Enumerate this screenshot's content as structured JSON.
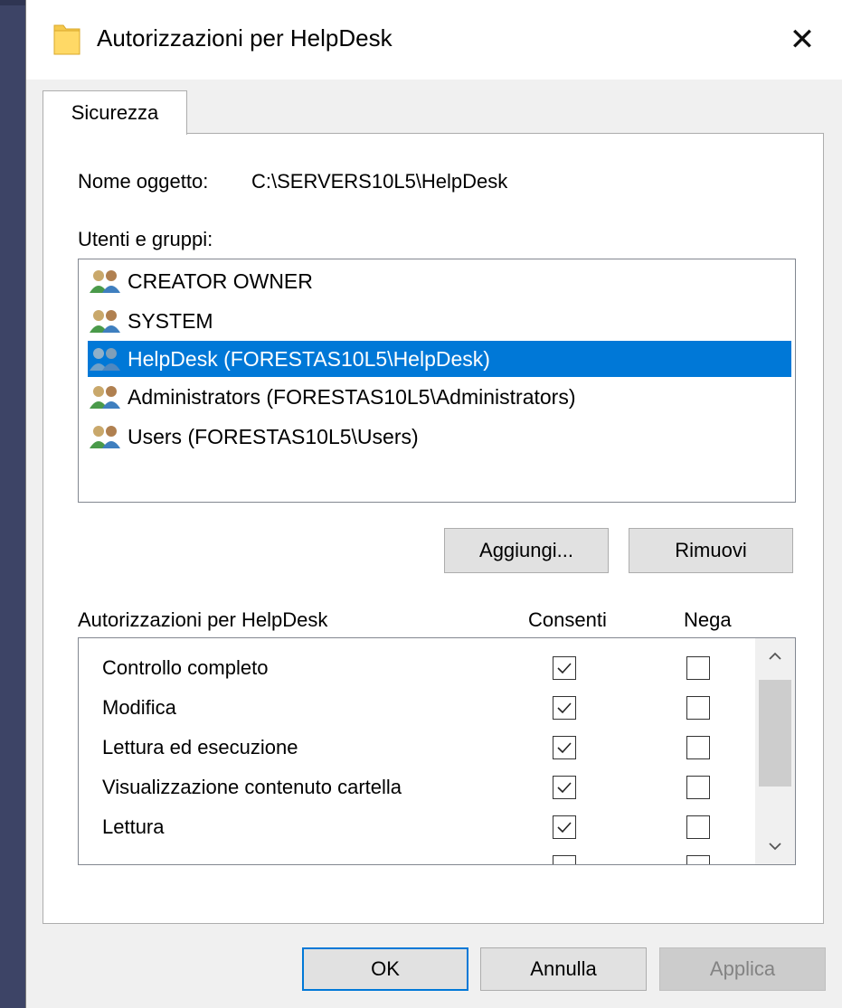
{
  "window": {
    "title": "Autorizzazioni per HelpDesk",
    "close_glyph": "✕"
  },
  "tabs": [
    {
      "label": "Sicurezza",
      "active": true
    }
  ],
  "object": {
    "label": "Nome oggetto:",
    "value": "C:\\SERVERS10L5\\HelpDesk"
  },
  "users": {
    "label": "Utenti e gruppi:",
    "items": [
      {
        "name": "CREATOR OWNER",
        "icon": "users-group-icon",
        "selected": false
      },
      {
        "name": "SYSTEM",
        "icon": "users-group-icon",
        "selected": false
      },
      {
        "name": "HelpDesk (FORESTAS10L5\\HelpDesk)",
        "icon": "users-group-icon",
        "selected": true
      },
      {
        "name": "Administrators (FORESTAS10L5\\Administrators)",
        "icon": "users-group-icon",
        "selected": false
      },
      {
        "name": "Users (FORESTAS10L5\\Users)",
        "icon": "users-group-icon",
        "selected": false
      }
    ],
    "add_label": "Aggiungi...",
    "remove_label": "Rimuovi"
  },
  "permissions": {
    "label": "Autorizzazioni per HelpDesk",
    "allow_header": "Consenti",
    "deny_header": "Nega",
    "rows": [
      {
        "name": "Controllo completo",
        "allow": true,
        "deny": false
      },
      {
        "name": "Modifica",
        "allow": true,
        "deny": false
      },
      {
        "name": "Lettura ed esecuzione",
        "allow": true,
        "deny": false
      },
      {
        "name": "Visualizzazione contenuto cartella",
        "allow": true,
        "deny": false
      },
      {
        "name": "Lettura",
        "allow": true,
        "deny": false
      },
      {
        "name": "",
        "allow": true,
        "deny": false
      }
    ]
  },
  "footer": {
    "ok_label": "OK",
    "cancel_label": "Annulla",
    "apply_label": "Applica"
  },
  "colors": {
    "selection": "#0078d7",
    "dialog_bg": "#f0f0f0",
    "desktop_bg": "#3d4466",
    "disabled_text": "#838383"
  }
}
